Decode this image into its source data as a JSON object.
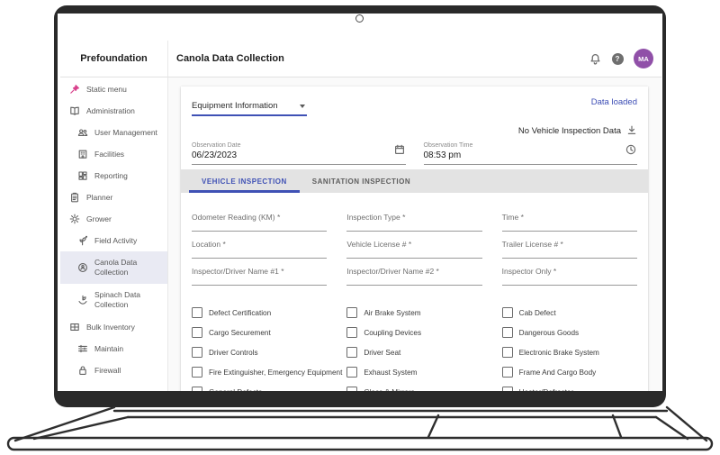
{
  "colors": {
    "accent_indigo": "#3f51b5",
    "status_link_blue": "#3d4eb5",
    "avatar_purple": "#9050a8",
    "pin_pink": "#d8418c",
    "tab_bar_gray": "#e3e3e3",
    "selected_item_bg": "#e9eaf3"
  },
  "appbar": {
    "brand": "Prefoundation",
    "title": "Canola Data Collection",
    "help_glyph": "?",
    "avatar_initials": "MA"
  },
  "sidebar": {
    "items": [
      {
        "label": "Static menu",
        "icon": "pin-icon",
        "level": 0
      },
      {
        "label": "Administration",
        "icon": "book-icon",
        "level": 0
      },
      {
        "label": "User Management",
        "icon": "people-icon",
        "level": 1
      },
      {
        "label": "Facilities",
        "icon": "building-icon",
        "level": 1
      },
      {
        "label": "Reporting",
        "icon": "dashboard-icon",
        "level": 1
      },
      {
        "label": "Planner",
        "icon": "clipboard-icon",
        "level": 0
      },
      {
        "label": "Grower",
        "icon": "gear-icon",
        "level": 0
      },
      {
        "label": "Field Activity",
        "icon": "plant-icon",
        "level": 1
      },
      {
        "label": "Canola Data Collection",
        "icon": "seed-icon",
        "level": 1,
        "selected": true
      },
      {
        "label": "Spinach Data Collection",
        "icon": "sprout-icon",
        "level": 1
      },
      {
        "label": "Bulk Inventory",
        "icon": "boxes-icon",
        "level": 0
      },
      {
        "label": "Maintain",
        "icon": "tune-icon",
        "level": 1
      },
      {
        "label": "Firewall",
        "icon": "lock-icon",
        "level": 1
      }
    ]
  },
  "content": {
    "status_text": "Data loaded",
    "download_label": "No Vehicle Inspection Data",
    "section_select_value": "Equipment Information",
    "date_field": {
      "label": "Observation Date",
      "value": "06/23/2023"
    },
    "time_field": {
      "label": "Observation Time",
      "value": "08:53 pm"
    },
    "tabs": [
      {
        "label": "VEHICLE INSPECTION",
        "active": true
      },
      {
        "label": "SANITATION INSPECTION",
        "active": false
      }
    ],
    "fields": [
      "Odometer Reading (KM) *",
      "Inspection Type *",
      "Time *",
      "Location *",
      "Vehicle License # *",
      "Trailer License # *",
      "Inspector/Driver Name #1 *",
      "Inspector/Driver Name #2 *",
      "Inspector Only *"
    ],
    "checkbox_columns": [
      [
        "Defect Certification",
        "Cargo Securement",
        "Driver Controls",
        "Fire Extinguisher, Emergency Equipment",
        "General Defects"
      ],
      [
        "Air Brake System",
        "Coupling Devices",
        "Driver Seat",
        "Exhaust System",
        "Glass & Mirrors"
      ],
      [
        "Cab Defect",
        "Dangerous Goods",
        "Electronic Brake System",
        "Frame And Cargo Body",
        "Heater/Defroster"
      ]
    ]
  }
}
